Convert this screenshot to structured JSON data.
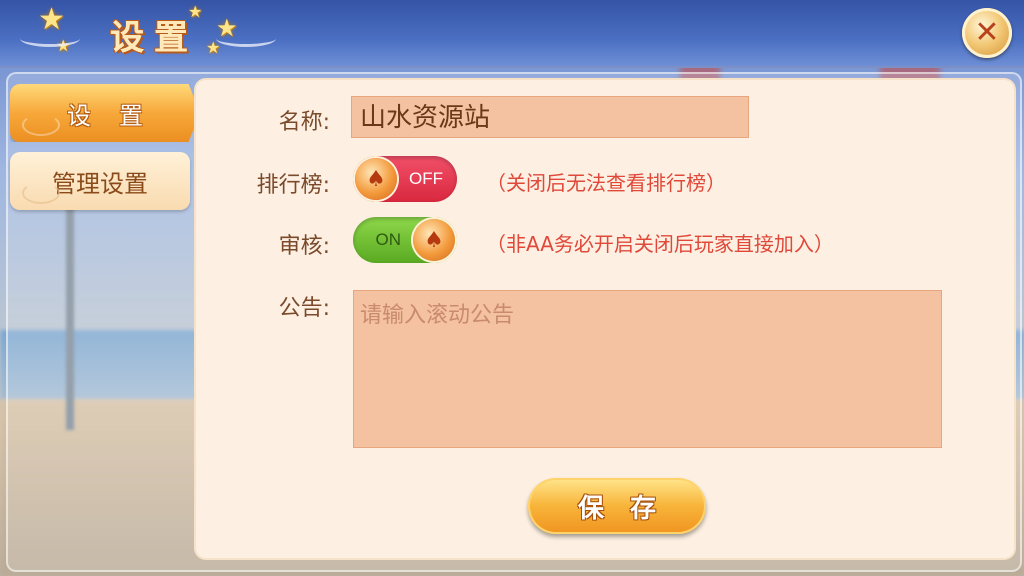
{
  "header": {
    "title": "设置",
    "close_icon": "close-icon"
  },
  "sidebar": {
    "items": [
      {
        "label": "设置",
        "active": true
      },
      {
        "label": "管理设置",
        "active": false
      }
    ]
  },
  "form": {
    "name": {
      "label": "名称:",
      "value": "山水资源站"
    },
    "ranking": {
      "label": "排行榜:",
      "toggle_text": "OFF",
      "state": "off",
      "hint": "（关闭后无法查看排行榜）"
    },
    "review": {
      "label": "审核:",
      "toggle_text": "ON",
      "state": "on",
      "hint": "（非AA务必开启关闭后玩家直接加入）"
    },
    "notice": {
      "label": "公告:",
      "placeholder": "请输入滚动公告"
    },
    "save_label": "保存"
  },
  "colors": {
    "accent": "#f7a83a",
    "toggle_off": "#d8283e",
    "toggle_on": "#5aaa22",
    "hint": "#e0483a"
  },
  "icons": {
    "toggle_knob": "spade-icon",
    "stars": "star-icon"
  }
}
